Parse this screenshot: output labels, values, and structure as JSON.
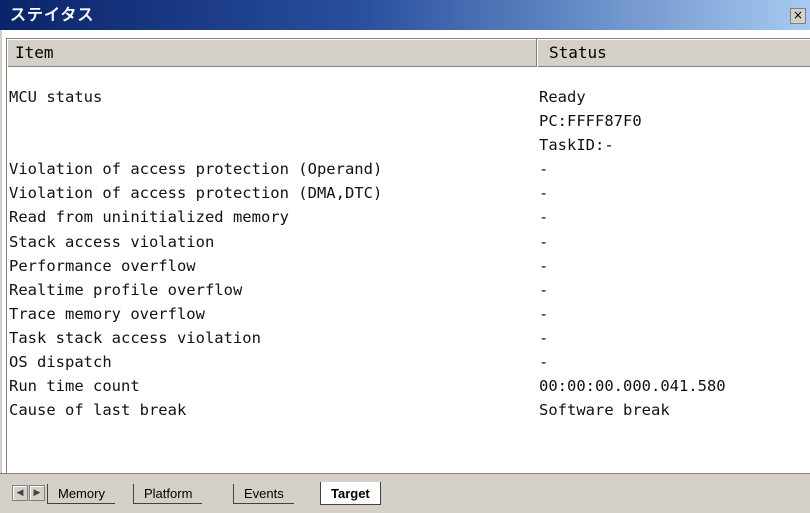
{
  "window": {
    "title": "ステイタス",
    "close_glyph": "×"
  },
  "table": {
    "headers": {
      "item": "Item",
      "status": "Status"
    },
    "rows": [
      {
        "item": "MCU status",
        "status": "Ready"
      },
      {
        "item": "",
        "status": "PC:FFFF87F0"
      },
      {
        "item": "",
        "status": "TaskID:-"
      },
      {
        "item": "Violation of access protection (Operand)",
        "status": "-"
      },
      {
        "item": "Violation of access protection (DMA,DTC)",
        "status": "-"
      },
      {
        "item": "Read from uninitialized memory",
        "status": "-"
      },
      {
        "item": "Stack access violation",
        "status": "-"
      },
      {
        "item": "Performance overflow",
        "status": "-"
      },
      {
        "item": "Realtime profile overflow",
        "status": "-"
      },
      {
        "item": "Trace memory overflow",
        "status": "-"
      },
      {
        "item": "Task stack access violation",
        "status": "-"
      },
      {
        "item": "OS dispatch",
        "status": "-"
      },
      {
        "item": "Run time count",
        "status": "00:00:00.000.041.580"
      },
      {
        "item": "Cause of last break",
        "status": "Software break"
      }
    ]
  },
  "tabs": {
    "scroll_left_glyph": "◀",
    "scroll_right_glyph": "▶",
    "items": [
      {
        "label": "Memory",
        "active": false
      },
      {
        "label": "Platform",
        "active": false
      },
      {
        "label": "Events",
        "active": false
      },
      {
        "label": "Target",
        "active": true
      }
    ]
  }
}
